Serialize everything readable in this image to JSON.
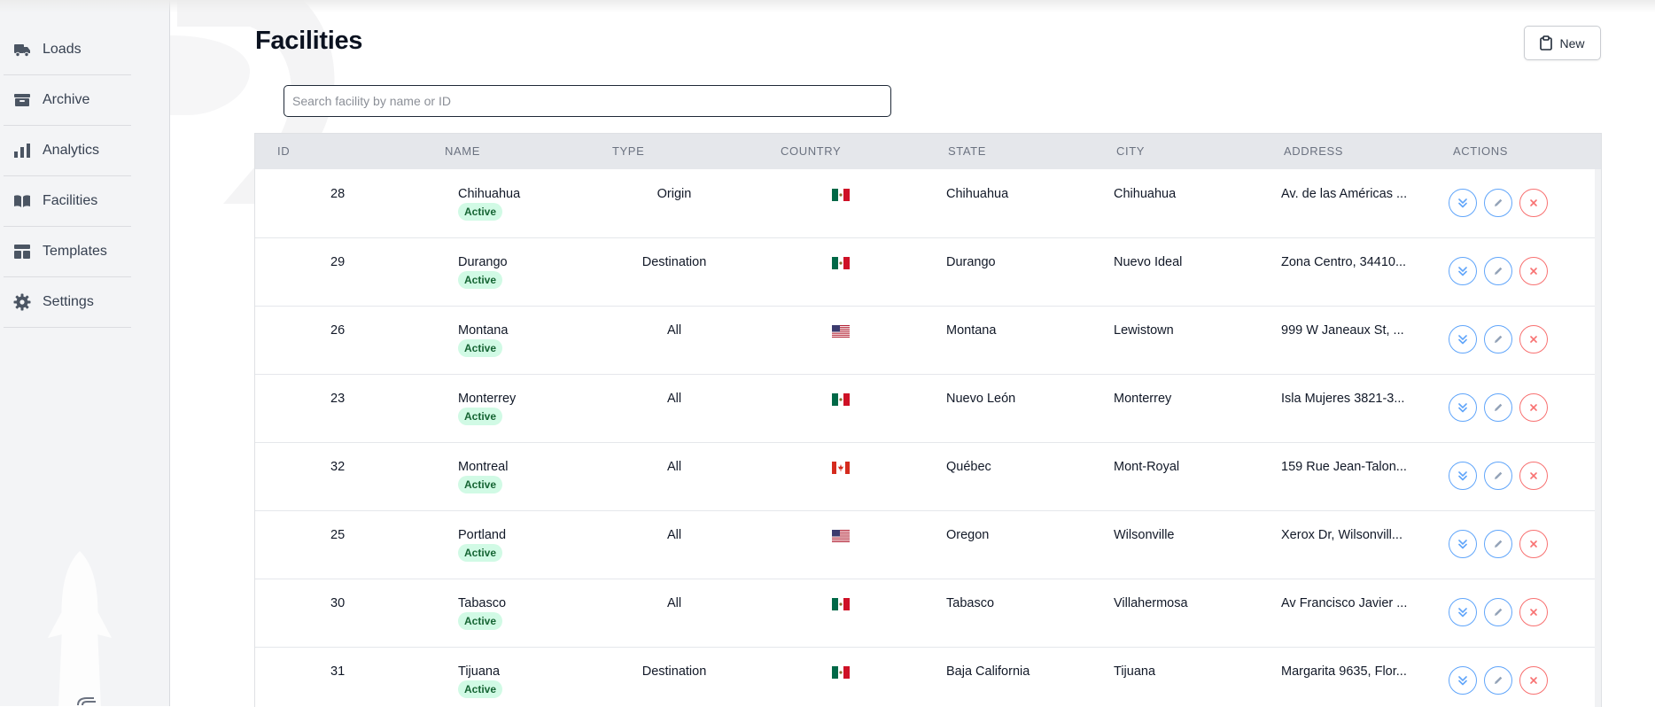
{
  "sidebar": {
    "items": [
      {
        "label": "Loads",
        "icon": "truck-icon"
      },
      {
        "label": "Archive",
        "icon": "archive-box-icon"
      },
      {
        "label": "Analytics",
        "icon": "bar-chart-icon"
      },
      {
        "label": "Facilities",
        "icon": "book-open-icon"
      },
      {
        "label": "Templates",
        "icon": "template-layout-icon"
      },
      {
        "label": "Settings",
        "icon": "gear-icon"
      }
    ]
  },
  "header": {
    "title": "Facilities",
    "new_button_label": "New",
    "new_button_icon": "clipboard-icon"
  },
  "search": {
    "placeholder": "Search facility by name or ID",
    "value": ""
  },
  "table": {
    "columns": [
      "ID",
      "NAME",
      "TYPE",
      "COUNTRY",
      "STATE",
      "CITY",
      "ADDRESS",
      "ACTIONS"
    ],
    "rows": [
      {
        "id": "28",
        "name": "Chihuahua",
        "status": "Active",
        "type": "Origin",
        "country": "MX",
        "state": "Chihuahua",
        "city": "Chihuahua",
        "address": "Av. de las Américas ..."
      },
      {
        "id": "29",
        "name": "Durango",
        "status": "Active",
        "type": "Destination",
        "country": "MX",
        "state": "Durango",
        "city": "Nuevo Ideal",
        "address": "Zona Centro, 34410..."
      },
      {
        "id": "26",
        "name": "Montana",
        "status": "Active",
        "type": "All",
        "country": "US",
        "state": "Montana",
        "city": "Lewistown",
        "address": "999 W Janeaux St, ..."
      },
      {
        "id": "23",
        "name": "Monterrey",
        "status": "Active",
        "type": "All",
        "country": "MX",
        "state": "Nuevo León",
        "city": "Monterrey",
        "address": "Isla Mujeres 3821-3..."
      },
      {
        "id": "32",
        "name": "Montreal",
        "status": "Active",
        "type": "All",
        "country": "CA",
        "state": "Québec",
        "city": "Mont-Royal",
        "address": "159 Rue Jean-Talon..."
      },
      {
        "id": "25",
        "name": "Portland",
        "status": "Active",
        "type": "All",
        "country": "US",
        "state": "Oregon",
        "city": "Wilsonville",
        "address": "Xerox Dr, Wilsonvill..."
      },
      {
        "id": "30",
        "name": "Tabasco",
        "status": "Active",
        "type": "All",
        "country": "MX",
        "state": "Tabasco",
        "city": "Villahermosa",
        "address": "Av Francisco Javier ..."
      },
      {
        "id": "31",
        "name": "Tijuana",
        "status": "Active",
        "type": "Destination",
        "country": "MX",
        "state": "Baja California",
        "city": "Tijuana",
        "address": "Margarita 9635, Flor..."
      }
    ],
    "action_icons": [
      "chevrons-down-icon",
      "pencil-icon",
      "close-icon"
    ]
  },
  "colors": {
    "sidebar_bg": "#f3f4f6",
    "header_bg": "#e5e7eb",
    "badge_bg": "#d1fae5",
    "badge_text": "#166534",
    "action_blue": "#60a5fa",
    "action_red": "#f87171"
  }
}
